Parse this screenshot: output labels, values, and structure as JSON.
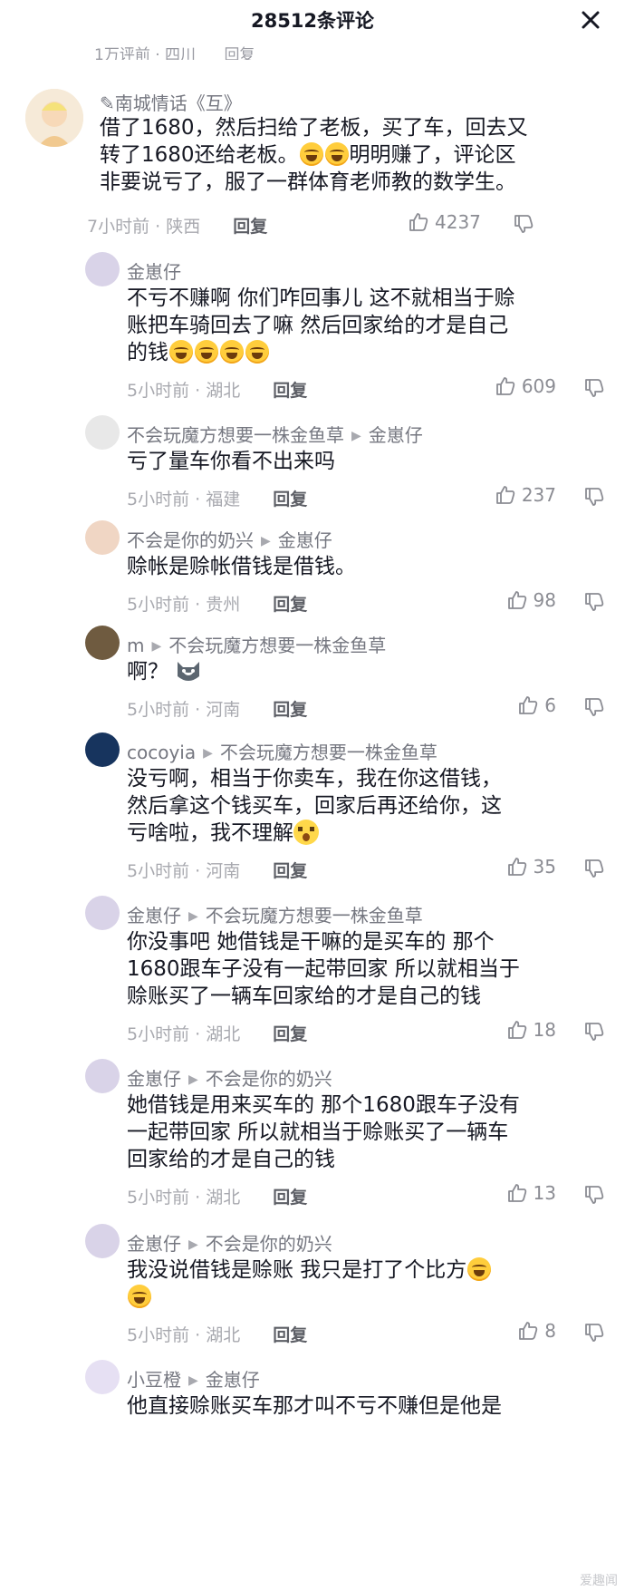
{
  "header": {
    "title": "28512条评论"
  },
  "peek": {
    "time": "1万评前 · 四川",
    "reply": "回复"
  },
  "comments": [
    {
      "user": "✎南城情话《互》",
      "text_lines": [
        "借了1680，然后扫给了老板，买了车，回去又",
        "转了1680还给老板。",
        "明明赚了，评论区",
        "非要说亏了，服了一群体育老师教的数学生。"
      ],
      "time_loc": "7小时前 · 陕西",
      "reply": "回复",
      "likes": "4237"
    },
    {
      "user": "金崽仔",
      "target": "",
      "text_lines": [
        "不亏不赚啊 你们咋回事儿 这不就相当于赊",
        "账把车骑回去了嘛 然后回家给的才是自己",
        "的钱"
      ],
      "time_loc": "5小时前 · 湖北",
      "reply": "回复",
      "likes": "609"
    },
    {
      "user": "不会玩魔方想要一株金鱼草",
      "target": "金崽仔",
      "text_lines": [
        "亏了量车你看不出来吗"
      ],
      "time_loc": "5小时前 · 福建",
      "reply": "回复",
      "likes": "237"
    },
    {
      "user": "不会是你的奶兴",
      "target": "金崽仔",
      "text_lines": [
        "赊帐是赊帐借钱是借钱。"
      ],
      "time_loc": "5小时前 · 贵州",
      "reply": "回复",
      "likes": "98"
    },
    {
      "user": "m",
      "target": "不会玩魔方想要一株金鱼草",
      "text_lines": [
        "啊？"
      ],
      "time_loc": "5小时前 · 河南",
      "reply": "回复",
      "likes": "6"
    },
    {
      "user": "cocoyia",
      "target": "不会玩魔方想要一株金鱼草",
      "text_lines": [
        "没亏啊，相当于你卖车，我在你这借钱，",
        "然后拿这个钱买车，回家后再还给你，这",
        "亏啥啦，我不理解"
      ],
      "time_loc": "5小时前 · 河南",
      "reply": "回复",
      "likes": "35"
    },
    {
      "user": "金崽仔",
      "target": "不会玩魔方想要一株金鱼草",
      "text_lines": [
        "你没事吧 她借钱是干嘛的是买车的 那个",
        "1680跟车子没有一起带回家 所以就相当于",
        "赊账买了一辆车回家给的才是自己的钱"
      ],
      "time_loc": "5小时前 · 湖北",
      "reply": "回复",
      "likes": "18"
    },
    {
      "user": "金崽仔",
      "target": "不会是你的奶兴",
      "text_lines": [
        "她借钱是用来买车的 那个1680跟车子没有",
        "一起带回家 所以就相当于赊账买了一辆车",
        "回家给的才是自己的钱"
      ],
      "time_loc": "5小时前 · 湖北",
      "reply": "回复",
      "likes": "13"
    },
    {
      "user": "金崽仔",
      "target": "不会是你的奶兴",
      "text_lines": [
        "我没说借钱是赊账 我只是打了个比方",
        ""
      ],
      "time_loc": "5小时前 · 湖北",
      "reply": "回复",
      "likes": "8"
    },
    {
      "user": "小豆橙",
      "target": "金崽仔",
      "text_lines": [
        "他直接赊账买车那才叫不亏不赚但是他是"
      ],
      "time_loc": "",
      "reply": "",
      "likes": ""
    }
  ],
  "watermark": "爱趣闻",
  "icons": {
    "close": "close-icon",
    "like": "thumb-up-icon",
    "dislike": "thumb-down-icon",
    "arrow": "reply-arrow-icon"
  },
  "colors": {
    "text": "#161823",
    "meta": "#a8a9af",
    "username": "#757780"
  }
}
